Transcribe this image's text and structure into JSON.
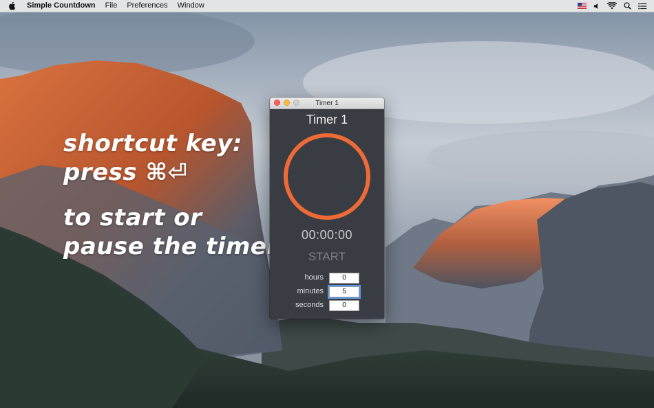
{
  "menubar": {
    "app_name": "Simple Countdown",
    "menus": [
      "File",
      "Preferences",
      "Window"
    ],
    "status_icons": [
      "flag-us-icon",
      "volume-icon",
      "wifi-icon",
      "spotlight-icon",
      "notification-center-icon"
    ]
  },
  "promo": {
    "lines_1": [
      "shortcut key:",
      "press ⌘⏎"
    ],
    "lines_2": [
      "to start or",
      "pause the timer"
    ]
  },
  "window": {
    "title": "Timer 1",
    "timer_name": "Timer 1",
    "time_display": "00:00:00",
    "start_label": "START",
    "ring_color": "#ee6a37",
    "fields": [
      {
        "label": "hours",
        "value": "0"
      },
      {
        "label": "minutes",
        "value": "5"
      },
      {
        "label": "seconds",
        "value": "0"
      }
    ]
  },
  "colors": {
    "window_bg": "#3a3c43",
    "accent_ring": "#ee6a37"
  }
}
